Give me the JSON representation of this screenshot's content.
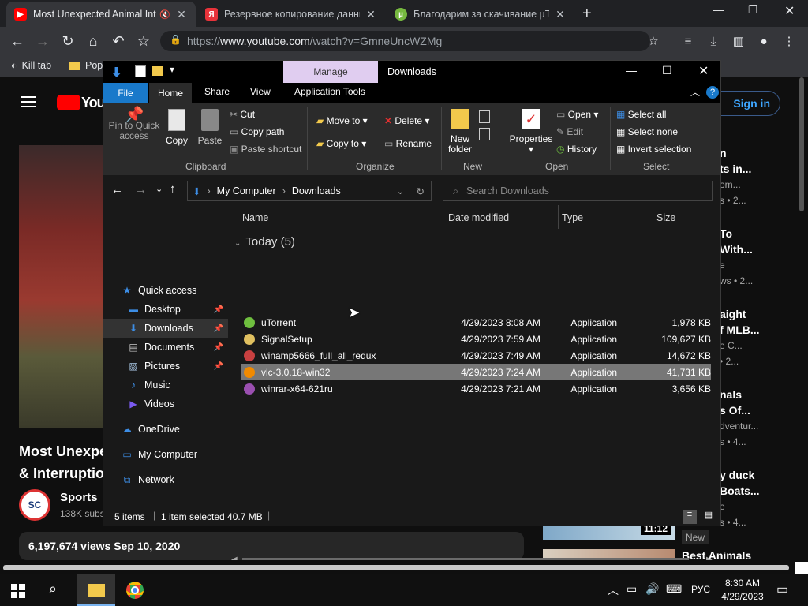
{
  "browser": {
    "tabs": [
      {
        "title": "Most Unexpected Animal Int",
        "icon": "youtube-icon"
      },
      {
        "title": "Резервное копирование данны",
        "icon": "yandex-icon"
      },
      {
        "title": "Благодарим за скачивание µTor",
        "icon": "utorrent-icon"
      }
    ],
    "url_domain": "www.youtube.com",
    "url_prefix": "https://",
    "url_path": "/watch?v=GmneUncWZMg",
    "bookmarks": [
      {
        "label": "Kill tab"
      },
      {
        "label": "Pop"
      }
    ]
  },
  "youtube": {
    "logo": "You",
    "sign_in": "Sign in",
    "video_title_1": "Most Unexpe",
    "video_title_2": "& Interruptio",
    "channel": "Sports",
    "subs": "138K subs",
    "views": "6,197,674 views  Sep 10, 2020",
    "side": [
      {
        "t1": "n",
        "t2": "ts in...",
        "m1": "om...",
        "m2": "s • 2..."
      },
      {
        "t1": "To",
        "t2": "With...",
        "m1": "e",
        "m2": "ws • 2..."
      },
      {
        "t1": "aight",
        "t2": "f MLB...",
        "m1": "e C...",
        "m2": "• 2..."
      },
      {
        "t1": "nals",
        "t2": "s Of...",
        "m1": "dventur...",
        "m2": "s • 4..."
      },
      {
        "t1": "y duck",
        "t2": "Boats...",
        "m1": "e",
        "m2": "s • 4..."
      }
    ],
    "duration": "11:12",
    "new_badge": "New",
    "best_animals": "Best Animals"
  },
  "explorer": {
    "manage": "Manage",
    "title": "Downloads",
    "tabs": [
      "File",
      "Home",
      "Share",
      "View",
      "Application Tools"
    ],
    "clipboard": {
      "pin": "Pin to Quick access",
      "copy": "Copy",
      "paste": "Paste",
      "cut": "Cut",
      "copy_path": "Copy path",
      "paste_shortcut": "Paste shortcut",
      "group": "Clipboard"
    },
    "organize": {
      "move_to": "Move to",
      "copy_to": "Copy to",
      "delete": "Delete",
      "rename": "Rename",
      "group": "Organize"
    },
    "new": {
      "folder": "New folder",
      "group": "New"
    },
    "open": {
      "properties": "Properties",
      "open": "Open",
      "edit": "Edit",
      "history": "History",
      "group": "Open"
    },
    "select": {
      "all": "Select all",
      "none": "Select none",
      "invert": "Invert selection",
      "group": "Select"
    },
    "breadcrumb": [
      "My Computer",
      "Downloads"
    ],
    "search_placeholder": "Search Downloads",
    "nav": [
      {
        "label": "Quick access",
        "icon": "star-icon"
      },
      {
        "label": "Desktop",
        "icon": "desktop-icon",
        "pin": true
      },
      {
        "label": "Downloads",
        "icon": "download-icon",
        "pin": true
      },
      {
        "label": "Documents",
        "icon": "documents-icon",
        "pin": true
      },
      {
        "label": "Pictures",
        "icon": "pictures-icon",
        "pin": true
      },
      {
        "label": "Music",
        "icon": "music-icon"
      },
      {
        "label": "Videos",
        "icon": "videos-icon"
      },
      {
        "label": "OneDrive",
        "icon": "cloud-icon"
      },
      {
        "label": "My Computer",
        "icon": "computer-icon"
      },
      {
        "label": "Network",
        "icon": "network-icon"
      }
    ],
    "columns": [
      "Name",
      "Date modified",
      "Type",
      "Size"
    ],
    "group_header": "Today (5)",
    "files": [
      {
        "name": "uTorrent",
        "date": "4/29/2023 8:08 AM",
        "type": "Application",
        "size": "1,978 KB",
        "color": "#6fbf3f"
      },
      {
        "name": "SignalSetup",
        "date": "4/29/2023 7:59 AM",
        "type": "Application",
        "size": "109,627 KB",
        "color": "#e0c060"
      },
      {
        "name": "winamp5666_full_all_redux",
        "date": "4/29/2023 7:49 AM",
        "type": "Application",
        "size": "14,672 KB",
        "color": "#c84040"
      },
      {
        "name": "vlc-3.0.18-win32",
        "date": "4/29/2023 7:24 AM",
        "type": "Application",
        "size": "41,731 KB",
        "color": "#f08a00"
      },
      {
        "name": "winrar-x64-621ru",
        "date": "4/29/2023 7:21 AM",
        "type": "Application",
        "size": "3,656 KB",
        "color": "#9a4fb0"
      }
    ],
    "status": {
      "items": "5 items",
      "selected": "1 item selected  40.7 MB"
    }
  },
  "taskbar": {
    "time": "8:30 AM",
    "date": "4/29/2023",
    "lang": "РУС"
  }
}
